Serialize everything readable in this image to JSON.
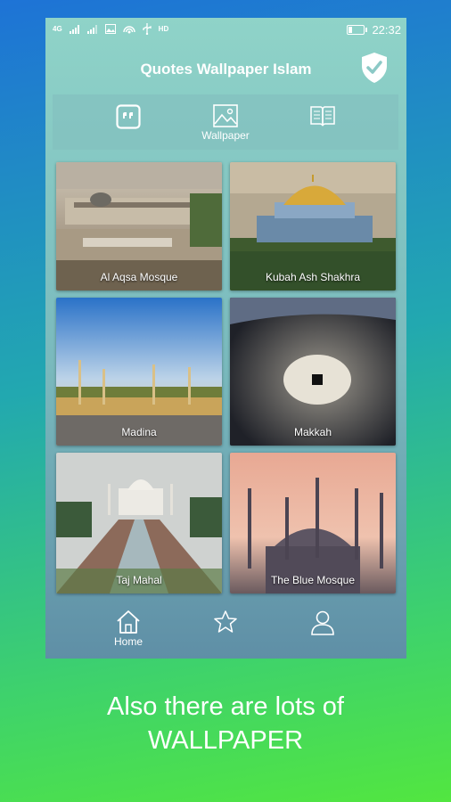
{
  "status_bar": {
    "network": "4G",
    "hd": "HD",
    "time": "22:32",
    "battery_level": 0.2
  },
  "app": {
    "title": "Quotes Wallpaper Islam"
  },
  "tabs": [
    {
      "icon": "quote-icon",
      "label": ""
    },
    {
      "icon": "image-icon",
      "label": "Wallpaper"
    },
    {
      "icon": "book-icon",
      "label": ""
    }
  ],
  "wallpapers": [
    {
      "name": "Al Aqsa Mosque"
    },
    {
      "name": "Kubah Ash Shakhra"
    },
    {
      "name": "Madina"
    },
    {
      "name": "Makkah"
    },
    {
      "name": "Taj Mahal"
    },
    {
      "name": "The Blue Mosque"
    }
  ],
  "bottom_nav": [
    {
      "icon": "home-icon",
      "label": "Home"
    },
    {
      "icon": "star-icon",
      "label": ""
    },
    {
      "icon": "user-icon",
      "label": ""
    }
  ],
  "caption": {
    "line1": "Also there are lots of",
    "line2": "WALLPAPER"
  },
  "colors": {
    "accent": "#ffffff",
    "gradient_top": "#1e73d6",
    "gradient_bottom": "#52e640"
  }
}
